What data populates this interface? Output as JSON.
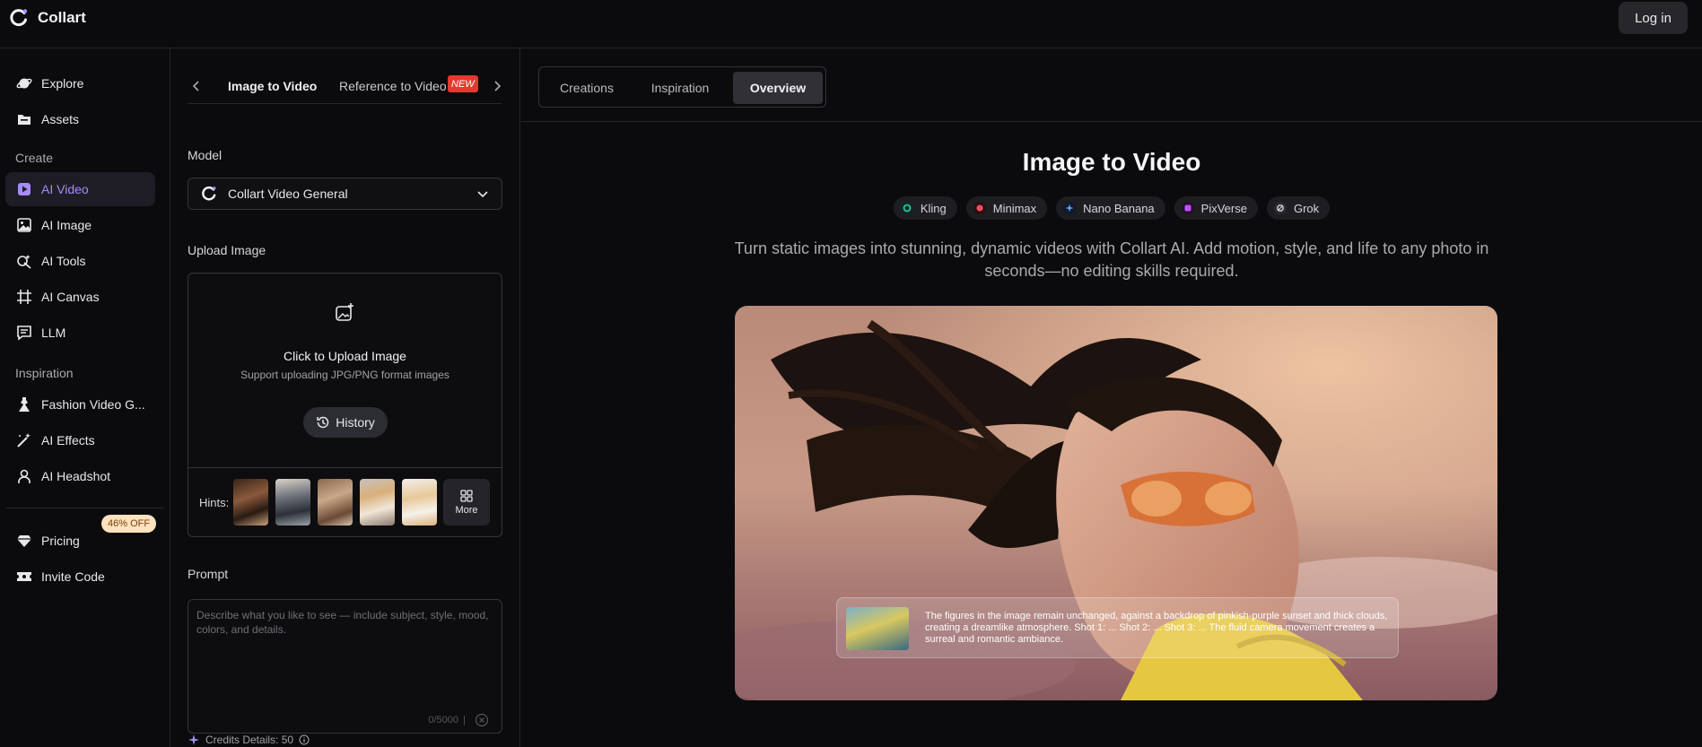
{
  "app": {
    "name": "Collart",
    "login_label": "Log in"
  },
  "nav": {
    "items_top": [
      {
        "label": "Explore",
        "icon": "planet-icon"
      },
      {
        "label": "Assets",
        "icon": "folder-icon"
      }
    ],
    "create_label": "Create",
    "create_items": [
      {
        "label": "AI Video",
        "icon": "play-square-icon",
        "active": true
      },
      {
        "label": "AI Image",
        "icon": "image-icon"
      },
      {
        "label": "AI Tools",
        "icon": "magic-tools-icon"
      },
      {
        "label": "AI Canvas",
        "icon": "canvas-grid-icon"
      },
      {
        "label": "LLM",
        "icon": "chat-icon"
      }
    ],
    "inspiration_label": "Inspiration",
    "inspiration_items": [
      {
        "label": "Fashion Video G...",
        "icon": "dress-icon"
      },
      {
        "label": "AI Effects",
        "icon": "wand-icon"
      },
      {
        "label": "AI Headshot",
        "icon": "person-icon"
      }
    ],
    "bottom_items": [
      {
        "label": "Pricing",
        "icon": "diamond-icon"
      },
      {
        "label": "Invite Code",
        "icon": "ticket-icon"
      }
    ],
    "discount_badge": "46% OFF"
  },
  "panel": {
    "tab_active": "Image to Video",
    "tab_other": "Reference to Video",
    "new_badge": "NEW",
    "model_label": "Model",
    "model_value": "Collart Video General",
    "upload_label": "Upload Image",
    "upload_title": "Click to Upload Image",
    "upload_sub": "Support uploading JPG/PNG format images",
    "history_label": "History",
    "hints_label": "Hints:",
    "more_label": "More",
    "prompt_label": "Prompt",
    "prompt_placeholder": "Describe what you like to see — include subject, style, mood, colors, and details.",
    "prompt_counter": "0/5000",
    "prompt_counter_sep": "|",
    "credits_label": "Credits Details: 50"
  },
  "main": {
    "tabs": [
      "Creations",
      "Inspiration",
      "Overview"
    ],
    "active_tab": "Overview",
    "title": "Image to Video",
    "chips": [
      {
        "label": "Kling",
        "color": "#2fd3b4"
      },
      {
        "label": "Minimax",
        "color": "#ff4d5e"
      },
      {
        "label": "Nano Banana",
        "color": "#6aa6ff"
      },
      {
        "label": "PixVerse",
        "color": "#c04dff"
      },
      {
        "label": "Grok",
        "color": "#d6d6db"
      }
    ],
    "description": "Turn static images into stunning, dynamic videos with Collart AI. Add motion, style, and life to any photo in seconds—no editing skills required.",
    "caption": "The figures in the image remain unchanged, against a backdrop of pinkish-purple sunset and thick clouds, creating a dreamlike atmosphere. Shot 1: ... Shot 2: ... Shot 3: ... The fluid camera movement creates a surreal and romantic ambiance."
  },
  "colors": {
    "accent": "#a78bfa",
    "new_badge": "#e23b2e",
    "discount_badge_bg": "#fde2bd"
  }
}
